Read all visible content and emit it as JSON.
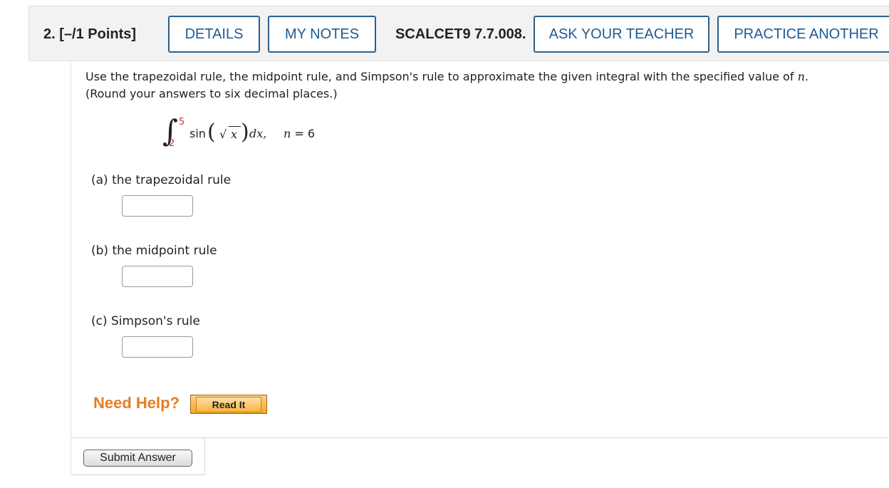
{
  "header": {
    "question_number": "2.  [–/1 Points]",
    "details_label": "DETAILS",
    "my_notes_label": "MY NOTES",
    "reference": "SCALCET9 7.7.008.",
    "ask_teacher_label": "ASK YOUR TEACHER",
    "practice_another_label": "PRACTICE ANOTHER"
  },
  "prompt": {
    "line1_before": "Use the trapezoidal rule, the midpoint rule, and Simpson's rule to approximate the given integral with the specified value of ",
    "line1_var": "n",
    "line1_after": ".",
    "line2": "(Round your answers to six decimal places.)"
  },
  "formula": {
    "upper_limit": "5",
    "lower_limit": "2",
    "function": "sin",
    "radicand": "x",
    "differential": "dx,",
    "n_var": "n",
    "n_value": "= 6"
  },
  "parts": [
    {
      "label": "(a)   the trapezoidal rule",
      "value": ""
    },
    {
      "label": "(b)   the midpoint rule",
      "value": ""
    },
    {
      "label": "(c)   Simpson's rule",
      "value": ""
    }
  ],
  "help": {
    "need_help_label": "Need Help?",
    "read_it_label": "Read It"
  },
  "submit_label": "Submit Answer"
}
